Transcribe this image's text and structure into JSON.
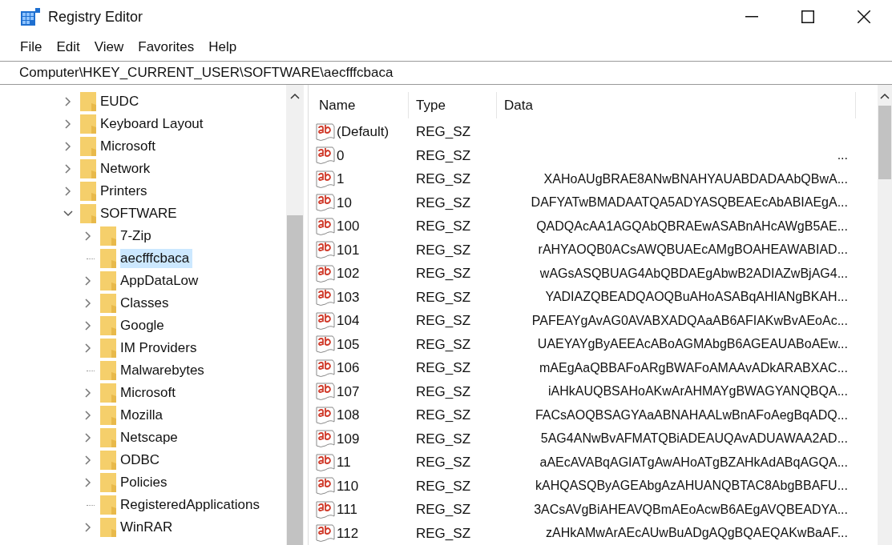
{
  "window": {
    "title": "Registry Editor"
  },
  "menu": [
    "File",
    "Edit",
    "View",
    "Favorites",
    "Help"
  ],
  "address": "Computer\\HKEY_CURRENT_USER\\SOFTWARE\\aecfffcbaca",
  "tree": [
    {
      "label": "EUDC",
      "expandable": true,
      "expanded": false,
      "selected": false
    },
    {
      "label": "Keyboard Layout",
      "expandable": true,
      "expanded": false,
      "selected": false
    },
    {
      "label": "Microsoft",
      "expandable": true,
      "expanded": false,
      "selected": false
    },
    {
      "label": "Network",
      "expandable": true,
      "expanded": false,
      "selected": false
    },
    {
      "label": "Printers",
      "expandable": true,
      "expanded": false,
      "selected": false
    },
    {
      "label": "SOFTWARE",
      "expandable": true,
      "expanded": true,
      "selected": false,
      "children": [
        {
          "label": "7-Zip",
          "expandable": true,
          "expanded": false,
          "selected": false
        },
        {
          "label": "aecfffcbaca",
          "expandable": false,
          "selected": true
        },
        {
          "label": "AppDataLow",
          "expandable": true,
          "expanded": false,
          "selected": false
        },
        {
          "label": "Classes",
          "expandable": true,
          "expanded": false,
          "selected": false
        },
        {
          "label": "Google",
          "expandable": true,
          "expanded": false,
          "selected": false
        },
        {
          "label": "IM Providers",
          "expandable": true,
          "expanded": false,
          "selected": false
        },
        {
          "label": "Malwarebytes",
          "expandable": false,
          "selected": false
        },
        {
          "label": "Microsoft",
          "expandable": true,
          "expanded": false,
          "selected": false
        },
        {
          "label": "Mozilla",
          "expandable": true,
          "expanded": false,
          "selected": false
        },
        {
          "label": "Netscape",
          "expandable": true,
          "expanded": false,
          "selected": false
        },
        {
          "label": "ODBC",
          "expandable": true,
          "expanded": false,
          "selected": false
        },
        {
          "label": "Policies",
          "expandable": true,
          "expanded": false,
          "selected": false
        },
        {
          "label": "RegisteredApplications",
          "expandable": false,
          "selected": false
        },
        {
          "label": "WinRAR",
          "expandable": true,
          "expanded": false,
          "selected": false
        }
      ]
    }
  ],
  "table": {
    "columns": [
      "Name",
      "Type",
      "Data"
    ],
    "rows": [
      [
        "(Default)",
        "REG_SZ",
        ""
      ],
      [
        "0",
        "REG_SZ",
        "..."
      ],
      [
        "1",
        "REG_SZ",
        "XAHoAUgBRAE8ANwBNAHYAUABDADAAbQBwA..."
      ],
      [
        "10",
        "REG_SZ",
        "DAFYATwBMADAATQA5ADYASQBEAEcAbABIAEgA..."
      ],
      [
        "100",
        "REG_SZ",
        "QADQAcAA1AGQAbQBRAEwASABnAHcAWgB5AE..."
      ],
      [
        "101",
        "REG_SZ",
        "rAHYAOQB0ACsAWQBUAEcAMgBOAHEAWABIAD..."
      ],
      [
        "102",
        "REG_SZ",
        "wAGsASQBUAG4AbQBDAEgAbwB2ADIAZwBjAG4..."
      ],
      [
        "103",
        "REG_SZ",
        "YADIAZQBEADQAOQBuAHoASABqAHIANgBKAH..."
      ],
      [
        "104",
        "REG_SZ",
        "PAFEAYgAvAG0AVABXADQAaAB6AFIAKwBvAEoAc..."
      ],
      [
        "105",
        "REG_SZ",
        "UAEYAYgByAEEAcABoAGMAbgB6AGEAUABoAEw..."
      ],
      [
        "106",
        "REG_SZ",
        "mAEgAaQBBAFoARgBWAFoAMAAvADkARABXAC..."
      ],
      [
        "107",
        "REG_SZ",
        "iAHkAUQBSAHoAKwArAHMAYgBWAGYANQBQA..."
      ],
      [
        "108",
        "REG_SZ",
        "FACsAOQBSAGYAaABNAHAALwBnAFoAegBqADQ..."
      ],
      [
        "109",
        "REG_SZ",
        "5AG4ANwBvAFMATQBiADEAUQAvADUAWAA2AD..."
      ],
      [
        "11",
        "REG_SZ",
        "aAEcAVABqAGIATgAwAHoATgBZAHkAdABqAGQA..."
      ],
      [
        "110",
        "REG_SZ",
        "kAHQASQByAGEAbgAzAHUANQBTAC8AbgBBAFU..."
      ],
      [
        "111",
        "REG_SZ",
        "3ACsAVgBiAHEAVQBmAEoAcwB6AEgAVQBEADYA..."
      ],
      [
        "112",
        "REG_SZ",
        "zAHkAMwArAEcAUwBuADgAQgBQAEQAKwBaAF..."
      ]
    ]
  }
}
